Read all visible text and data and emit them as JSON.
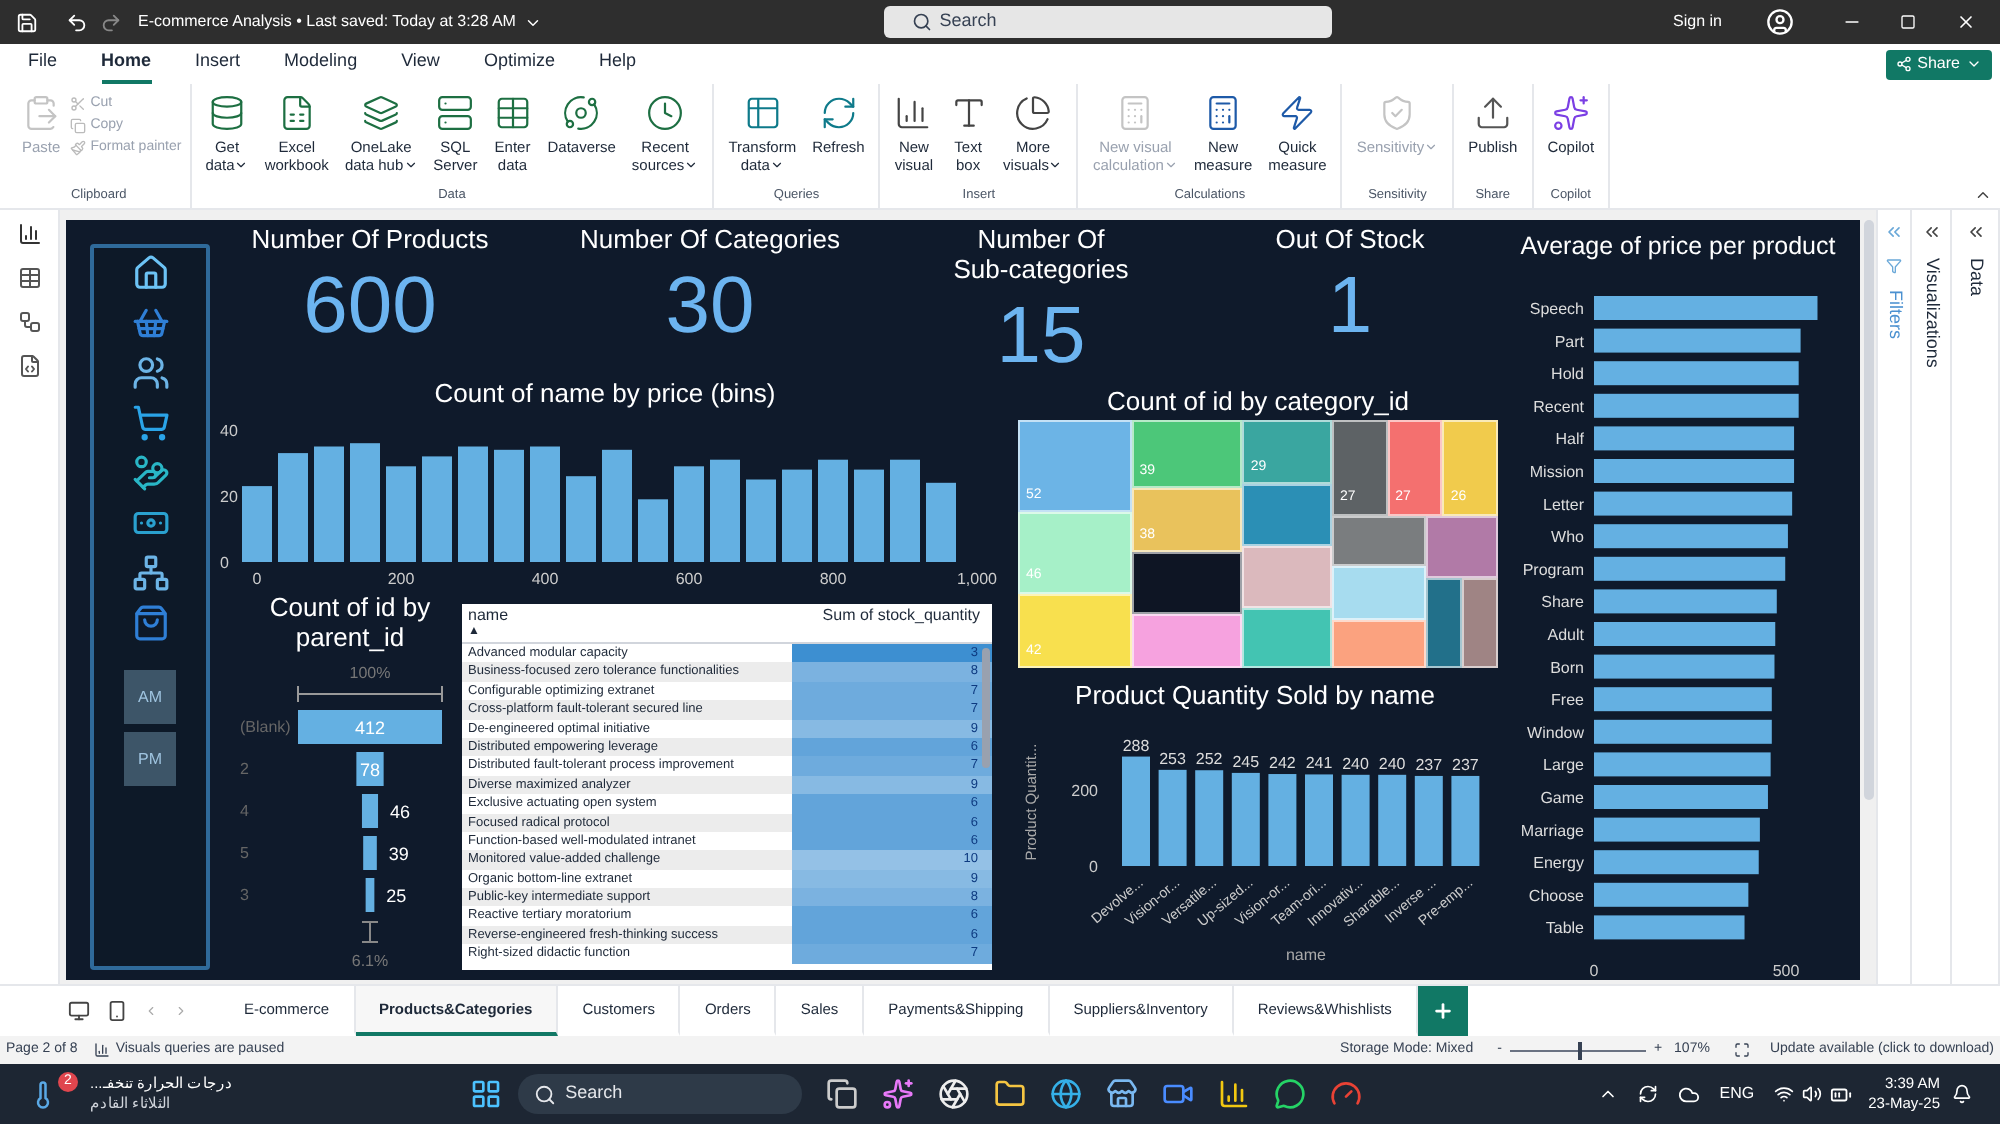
{
  "title_bar": {
    "title": "E-commerce Analysis • Last saved: Today at 3:28 AM",
    "search_placeholder": "Search",
    "sign_in": "Sign in"
  },
  "menu": {
    "tabs": [
      {
        "label": "File",
        "selected": false
      },
      {
        "label": "Home",
        "selected": true
      },
      {
        "label": "Insert",
        "selected": false
      },
      {
        "label": "Modeling",
        "selected": false
      },
      {
        "label": "View",
        "selected": false
      },
      {
        "label": "Optimize",
        "selected": false
      },
      {
        "label": "Help",
        "selected": false
      }
    ],
    "share": "Share"
  },
  "ribbon": {
    "groups": [
      {
        "label": "Clipboard",
        "items": [
          {
            "kind": "large",
            "lines": [
              "Paste"
            ],
            "dropdown": false,
            "disabled": true
          },
          {
            "kind": "small",
            "lines": [
              "Cut"
            ],
            "dropdown": false,
            "disabled": true
          },
          {
            "kind": "small",
            "lines": [
              "Copy"
            ],
            "dropdown": false,
            "disabled": true
          },
          {
            "kind": "small",
            "lines": [
              "Format painter"
            ],
            "dropdown": false,
            "disabled": true
          }
        ]
      },
      {
        "label": "Data",
        "items": [
          {
            "kind": "large",
            "lines": [
              "Get",
              "data"
            ],
            "dropdown": true,
            "disabled": false
          },
          {
            "kind": "large",
            "lines": [
              "Excel",
              "workbook"
            ],
            "dropdown": false,
            "disabled": false
          },
          {
            "kind": "large",
            "lines": [
              "OneLake",
              "data hub"
            ],
            "dropdown": true,
            "disabled": false
          },
          {
            "kind": "large",
            "lines": [
              "SQL",
              "Server"
            ],
            "dropdown": false,
            "disabled": false
          },
          {
            "kind": "large",
            "lines": [
              "Enter",
              "data"
            ],
            "dropdown": false,
            "disabled": false
          },
          {
            "kind": "large",
            "lines": [
              "Dataverse"
            ],
            "dropdown": false,
            "disabled": false
          },
          {
            "kind": "large",
            "lines": [
              "Recent",
              "sources"
            ],
            "dropdown": true,
            "disabled": false
          }
        ]
      },
      {
        "label": "Queries",
        "items": [
          {
            "kind": "large",
            "lines": [
              "Transform",
              "data"
            ],
            "dropdown": true,
            "disabled": false
          },
          {
            "kind": "large",
            "lines": [
              "Refresh"
            ],
            "dropdown": false,
            "disabled": false
          }
        ]
      },
      {
        "label": "Insert",
        "items": [
          {
            "kind": "large",
            "lines": [
              "New",
              "visual"
            ],
            "dropdown": false,
            "disabled": false
          },
          {
            "kind": "large",
            "lines": [
              "Text",
              "box"
            ],
            "dropdown": false,
            "disabled": false
          },
          {
            "kind": "large",
            "lines": [
              "More",
              "visuals"
            ],
            "dropdown": true,
            "disabled": false
          }
        ]
      },
      {
        "label": "Calculations",
        "items": [
          {
            "kind": "large",
            "lines": [
              "New visual",
              "calculation"
            ],
            "dropdown": true,
            "disabled": true
          },
          {
            "kind": "large",
            "lines": [
              "New",
              "measure"
            ],
            "dropdown": false,
            "disabled": false
          },
          {
            "kind": "large",
            "lines": [
              "Quick",
              "measure"
            ],
            "dropdown": false,
            "disabled": false
          }
        ]
      },
      {
        "label": "Sensitivity",
        "items": [
          {
            "kind": "large",
            "lines": [
              "Sensitivity"
            ],
            "dropdown": true,
            "disabled": true
          }
        ]
      },
      {
        "label": "Share",
        "items": [
          {
            "kind": "large",
            "lines": [
              "Publish"
            ],
            "dropdown": false,
            "disabled": false
          }
        ]
      },
      {
        "label": "Copilot",
        "items": [
          {
            "kind": "large",
            "lines": [
              "Copilot"
            ],
            "dropdown": false,
            "disabled": false
          }
        ]
      }
    ]
  },
  "report": {
    "nav_buttons": [
      {
        "label": "AM"
      },
      {
        "label": "PM"
      }
    ],
    "cards": [
      {
        "title": "Number Of Products",
        "value": "600"
      },
      {
        "title": "Number Of Categories",
        "value": "30"
      },
      {
        "title": "Number Of Sub-categories",
        "value": "15"
      },
      {
        "title": "Out Of Stock",
        "value": "1"
      }
    ],
    "histogram": {
      "chart_data": {
        "type": "bar",
        "title": "Count of name by price (bins)",
        "x": [
          0,
          50,
          100,
          150,
          200,
          250,
          300,
          350,
          400,
          450,
          500,
          550,
          600,
          650,
          700,
          750,
          800,
          850,
          900,
          950
        ],
        "values": [
          23,
          33,
          35,
          36,
          29,
          32,
          35,
          34,
          35,
          26,
          34,
          19,
          29,
          31,
          25,
          28,
          31,
          28,
          31,
          24
        ],
        "xticks": [
          0,
          200,
          400,
          600,
          800,
          {
            "value": 1000,
            "label": "1,000"
          }
        ],
        "xlim": [
          -25,
          1000
        ],
        "yticks": [
          0,
          20,
          40
        ],
        "ylim": [
          0,
          40
        ]
      }
    },
    "funnel": {
      "title": "Count of id by parent_id",
      "top_label": "100%",
      "bottom_label": "6.1%",
      "stages": [
        {
          "label": "(Blank)",
          "value": "412"
        },
        {
          "label": "2",
          "value": "78"
        },
        {
          "label": "4",
          "value": "46"
        },
        {
          "label": "5",
          "value": "39"
        },
        {
          "label": "3",
          "value": "25"
        }
      ]
    },
    "table": {
      "columns": [
        {
          "label": "name",
          "sort": "▲"
        },
        {
          "label": "Sum of stock_quantity"
        }
      ],
      "rows": [
        [
          "Advanced modular capacity",
          "3"
        ],
        [
          "Business-focused zero tolerance functionalities",
          "8"
        ],
        [
          "Configurable optimizing extranet",
          "7"
        ],
        [
          "Cross-platform fault-tolerant secured line",
          "7"
        ],
        [
          "De-engineered optimal initiative",
          "9"
        ],
        [
          "Distributed empowering leverage",
          "6"
        ],
        [
          "Distributed fault-tolerant process improvement",
          "7"
        ],
        [
          "Diverse maximized analyzer",
          "9"
        ],
        [
          "Exclusive actuating open system",
          "6"
        ],
        [
          "Focused radical protocol",
          "6"
        ],
        [
          "Function-based well-modulated intranet",
          "6"
        ],
        [
          "Monitored value-added challenge",
          "10"
        ],
        [
          "Organic bottom-line extranet",
          "9"
        ],
        [
          "Public-key intermediate support",
          "8"
        ],
        [
          "Reactive tertiary moratorium",
          "6"
        ],
        [
          "Reverse-engineered fresh-thinking success",
          "6"
        ],
        [
          "Right-sized didactic function",
          "7"
        ]
      ]
    },
    "treemap": {
      "title": "Count of id by category_id",
      "cells": [
        {
          "label": "52",
          "color": "#6cb4e6"
        },
        {
          "label": "46",
          "color": "#a6f0c8"
        },
        {
          "label": "42",
          "color": "#f8e04e"
        },
        {
          "label": "39",
          "color": "#4cc779"
        },
        {
          "label": "38",
          "color": "#e9c25c"
        },
        {
          "color": "#0e1524"
        },
        {
          "color": "#f6a2df"
        },
        {
          "label": "29",
          "color": "#3aa6a0"
        },
        {
          "color": "#2b8fb5"
        },
        {
          "color": "#dbb9bd"
        },
        {
          "color": "#43c4b2"
        },
        {
          "label": "27",
          "color": "#5d6265"
        },
        {
          "label": "27",
          "color": "#f4706f"
        },
        {
          "label": "26",
          "color": "#f1cb4c"
        },
        {
          "color": "#7a7d7f"
        },
        {
          "color": "#a7dcef"
        },
        {
          "color": "#fba27f"
        },
        {
          "color": "#b17aa7"
        },
        {
          "color": "#22708a"
        },
        {
          "color": "#9f8484"
        }
      ]
    },
    "quantity_chart": {
      "chart_data": {
        "type": "bar",
        "title": "Product Quantity Sold by name",
        "xlabel": "name",
        "ylabel": "Product Quantit...",
        "categories": [
          "Devolve...",
          "Vision-or...",
          "Versatile...",
          "Up-sized...",
          "Vision-or...",
          "Team-ori...",
          "Innovativ...",
          "Sharable...",
          "Inverse ...",
          "Pre-emp..."
        ],
        "values": [
          288,
          253,
          252,
          245,
          242,
          241,
          240,
          240,
          237,
          237
        ],
        "yticks": [
          0,
          200
        ],
        "ylim": [
          0,
          300
        ],
        "data_labels": true
      }
    },
    "price_chart": {
      "chart_data": {
        "type": "bar",
        "orientation": "horizontal",
        "title": "Average of price per product",
        "categories": [
          "Speech",
          "Part",
          "Hold",
          "Recent",
          "Half",
          "Mission",
          "Letter",
          "Who",
          "Program",
          "Share",
          "Adult",
          "Born",
          "Free",
          "Window",
          "Large",
          "Game",
          "Marriage",
          "Energy",
          "Choose",
          "Table"
        ],
        "values": [
          582,
          538,
          533,
          533,
          521,
          521,
          516,
          505,
          498,
          476,
          472,
          470,
          463,
          463,
          460,
          453,
          432,
          429,
          402,
          392
        ],
        "xticks": [
          0,
          500
        ],
        "xlim": [
          0,
          600
        ]
      }
    }
  },
  "side_panes": [
    {
      "label": "Filters"
    },
    {
      "label": "Visualizations"
    },
    {
      "label": "Data"
    }
  ],
  "page_tabs": [
    {
      "label": "E-commerce",
      "selected": false
    },
    {
      "label": "Products&Categories",
      "selected": true
    },
    {
      "label": "Customers",
      "selected": false
    },
    {
      "label": "Orders",
      "selected": false
    },
    {
      "label": "Sales",
      "selected": false
    },
    {
      "label": "Payments&Shipping",
      "selected": false
    },
    {
      "label": "Suppliers&Inventory",
      "selected": false
    },
    {
      "label": "Reviews&Whishlists",
      "selected": false
    }
  ],
  "status_bar": {
    "page": "Page 2 of 8",
    "queries": "Visuals queries are paused",
    "storage": "Storage Mode: Mixed",
    "zoom_out": "-",
    "zoom_in": "+",
    "zoom_slider": {
      "level": 0.5
    },
    "zoom": "107%",
    "update": "Update available (click to download)"
  },
  "taskbar": {
    "weather_badge": "2",
    "weather_title": "درجات الحرارة تنخفـ...",
    "weather_subtitle": "الثلاثاء القادم",
    "search_placeholder": "Search",
    "language": "ENG",
    "time": "3:39 AM",
    "date": "23-May-25"
  }
}
